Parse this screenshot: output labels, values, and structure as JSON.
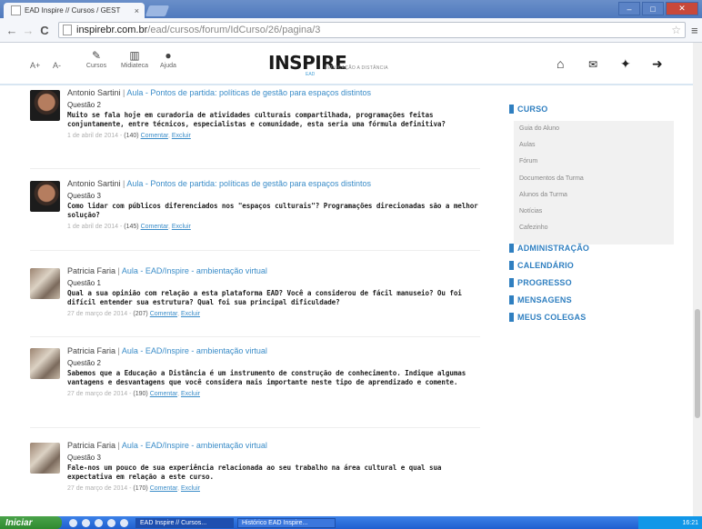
{
  "browser": {
    "tab_title": "EAD Inspire // Cursos / GEST",
    "tab_close": "×",
    "url_host": "inspirebr.com.br",
    "url_path": "/ead/cursos/forum/IdCurso/26/pagina/3",
    "back_icon": "←",
    "forward_icon": "→",
    "reload_icon": "C",
    "star_icon": "☆",
    "menu_icon": "≡",
    "min_icon": "–",
    "max_icon": "□",
    "close_icon": "✕"
  },
  "header": {
    "font_increase": "A+",
    "font_decrease": "A-",
    "tools": [
      {
        "icon": "✎",
        "label": "Cursos"
      },
      {
        "icon": "▥",
        "label": "Midiateca"
      },
      {
        "icon": "●",
        "label": "Ajuda"
      }
    ],
    "logo": "INSPIRE",
    "logo_tagline": "| EDUCAÇÃO A DISTÂNCIA",
    "logo_ead": "EAD",
    "home_icon": "⌂",
    "mail_icon": "✉",
    "tools_icon": "✦",
    "logout_icon": "➜"
  },
  "posts": [
    {
      "author": "Antonio Sartini",
      "link": "Aula - Pontos de partida: políticas de gestão para espaços distintos",
      "question": "Questão 2",
      "text": "Muito se fala hoje em curadoria de atividades culturais compartilhada, programações feitas conjuntamente, entre técnicos, especialistas e comunidade, esta seria uma fórmula definitiva?",
      "date": "1 de abril de 2014",
      "count": "(140)",
      "comment": "Comentar",
      "delete": "Excluir"
    },
    {
      "author": "Antonio Sartini",
      "link": "Aula - Pontos de partida: políticas de gestão para espaços distintos",
      "question": "Questão 3",
      "text": "Como lidar com públicos diferenciados nos \"espaços culturais\"? Programações direcionadas são a melhor solução?",
      "date": "1 de abril de 2014",
      "count": "(145)",
      "comment": "Comentar",
      "delete": "Excluir"
    },
    {
      "author": "Patricia Faria",
      "link": "Aula - EAD/Inspire - ambientação virtual",
      "question": "Questão 1",
      "text": "Qual a sua opinião com relação a esta plataforma EAD? Você a considerou de fácil manuseio? Ou foi difícil entender sua estrutura? Qual foi sua principal dificuldade?",
      "date": "27 de março de 2014",
      "count": "(207)",
      "comment": "Comentar",
      "delete": "Excluir"
    },
    {
      "author": "Patricia Faria",
      "link": "Aula - EAD/Inspire - ambientação virtual",
      "question": "Questão 2",
      "text": "Sabemos que a Educação a Distância é um instrumento de construção de conhecimento. Indique algumas vantagens e desvantagens que você considera mais importante neste tipo de aprendizado e comente.",
      "date": "27 de março de 2014",
      "count": "(190)",
      "comment": "Comentar",
      "delete": "Excluir"
    },
    {
      "author": "Patricia Faria",
      "link": "Aula - EAD/Inspire - ambientação virtual",
      "question": "Questão 3",
      "text": "Fale-nos um pouco de sua experiência relacionada ao seu trabalho na área cultural e qual sua expectativa em relação a este curso.",
      "date": "27 de março de 2014",
      "count": "(170)",
      "comment": "Comentar",
      "delete": "Excluir"
    }
  ],
  "sidebar": {
    "curso": "CURSO",
    "submenu": [
      "Guia do Aluno",
      "Aulas",
      "Fórum",
      "Documentos da Turma",
      "Alunos da Turma",
      "Notícias",
      "Cafezinho"
    ],
    "sections": [
      "ADMINISTRAÇÃO",
      "CALENDÁRIO",
      "PROGRESSO",
      "MENSAGENS",
      "MEUS COLEGAS"
    ]
  },
  "taskbar": {
    "start": "Iniciar",
    "tasks": [
      "EAD Inspire // Cursos...",
      "Histórico EAD Inspire..."
    ],
    "clock": "16:21"
  },
  "colors": {
    "accent": "#2f7fc0",
    "link": "#3a8cc8",
    "taskbar": "#1f5fcf"
  }
}
